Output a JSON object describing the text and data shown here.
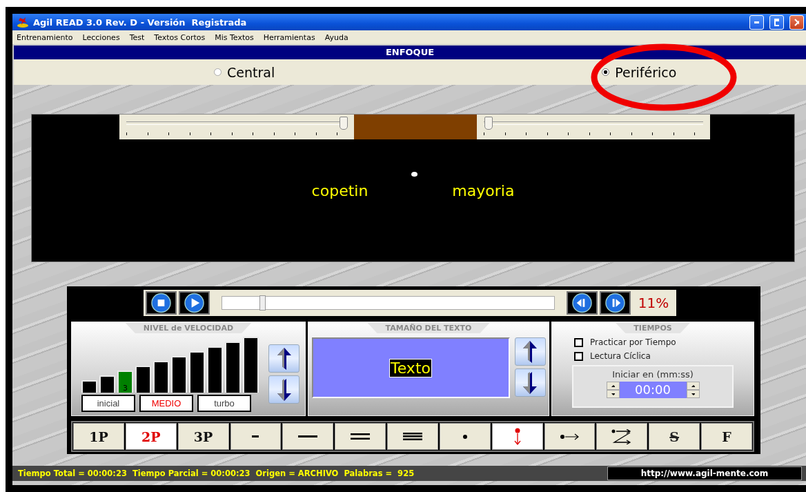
{
  "window": {
    "title": "Agil READ 3.0 Rev. D - Versión  Registrada"
  },
  "menu": [
    "Entrenamiento",
    "Lecciones",
    "Test",
    "Textos Cortos",
    "Mis Textos",
    "Herramientas",
    "Ayuda"
  ],
  "section_header": "ENFOQUE",
  "focus_options": [
    {
      "label": "Central",
      "selected": false
    },
    {
      "label": "Periférico",
      "selected": true
    }
  ],
  "display": {
    "sliders": [
      {
        "level": 0.98
      },
      {
        "level": 0.02
      }
    ],
    "words": [
      "copetin",
      "mayoria"
    ]
  },
  "transport": {
    "level": 0.12,
    "percent": "11%"
  },
  "speed_panel": {
    "title": "NIVEL de VELOCIDAD",
    "bars": [
      {
        "selected": false
      },
      {
        "selected": false
      },
      {
        "selected": true,
        "label": "3"
      },
      {
        "selected": false
      },
      {
        "selected": false
      },
      {
        "selected": false
      },
      {
        "selected": false
      },
      {
        "selected": false
      },
      {
        "selected": false
      },
      {
        "selected": false
      }
    ],
    "modes": [
      {
        "label": "inicial",
        "selected": false
      },
      {
        "label": "MEDIO",
        "selected": true
      },
      {
        "label": "turbo",
        "selected": false
      }
    ]
  },
  "text_size_panel": {
    "title": "TAMAÑO DEL TEXTO",
    "sample": "Texto"
  },
  "time_panel": {
    "title": "TIEMPOS",
    "options": [
      {
        "label": "Practicar por Tiempo",
        "checked": false
      },
      {
        "label": "Lectura Cíclica",
        "checked": false
      }
    ],
    "start_label": "Iniciar en (mm:ss)",
    "start_value": "00:00"
  },
  "mode_buttons": [
    {
      "kind": "text",
      "label": "1P",
      "selected": false
    },
    {
      "kind": "text",
      "label": "2P",
      "selected": true
    },
    {
      "kind": "text",
      "label": "3P",
      "selected": false
    },
    {
      "kind": "short-line",
      "selected": false
    },
    {
      "kind": "long-line",
      "selected": false
    },
    {
      "kind": "double-line",
      "selected": false
    },
    {
      "kind": "triple-line",
      "selected": false
    },
    {
      "kind": "dot",
      "selected": false
    },
    {
      "kind": "dot-down",
      "selected": true
    },
    {
      "kind": "dot-right",
      "selected": false
    },
    {
      "kind": "zigzag",
      "selected": false
    },
    {
      "kind": "strike",
      "label": "S",
      "selected": false
    },
    {
      "kind": "text",
      "label": "F",
      "selected": false
    }
  ],
  "status": "Tiempo Total = 00:00:23  Tiempo Parcial = 00:00:23  Origen = ARCHIVO  Palabras =  925",
  "url": "http://www.agil-mente.com"
}
